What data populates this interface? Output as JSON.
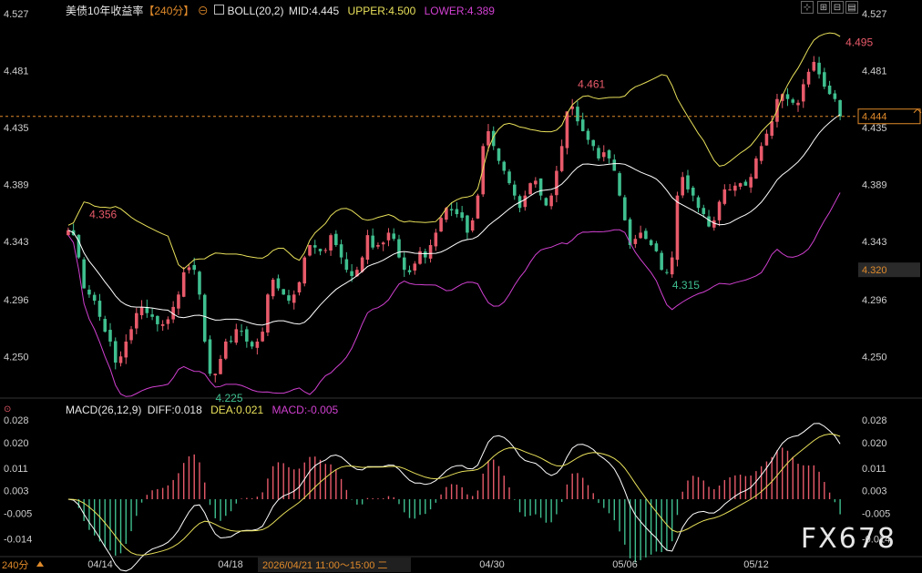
{
  "header": {
    "symbol": "美债10年收益率",
    "period_tag": "【240分】",
    "circle_icon": "⊖",
    "boll_label": "BOLL(20,2)",
    "mid": "MID:4.445",
    "upper": "UPPER:4.500",
    "lower": "LOWER:4.389"
  },
  "macd_header": {
    "label": "MACD(26,12,9)",
    "diff": "DIFF:0.018",
    "dea": "DEA:0.021",
    "macd": "MACD:-0.005"
  },
  "toolbar": {
    "icons": [
      "crosshair-icon",
      "zoom-in-icon",
      "zoom-out-icon",
      "settings-icon"
    ],
    "glyphs": [
      "⊹",
      "⊞",
      "⊟",
      "▤"
    ]
  },
  "price_axis": [
    "4.527",
    "4.481",
    "4.435",
    "4.389",
    "4.343",
    "4.296",
    "4.250"
  ],
  "macd_axis": [
    "0.028",
    "0.020",
    "0.011",
    "0.003",
    "-0.005",
    "-0.014"
  ],
  "markers": {
    "current_price": "4.444",
    "hover_price": "4.320"
  },
  "annotations": {
    "high_1": "4.356",
    "low_1": "4.225",
    "high_2": "4.461",
    "low_2": "4.315",
    "high_3": "4.495"
  },
  "x_axis": {
    "period": "240分",
    "dates": [
      "04/14",
      "04/18",
      "04/30",
      "05/06",
      "05/12"
    ],
    "crosshair_time": "2026/04/21 11:00～15:00 二"
  },
  "watermark": "FX678",
  "colors": {
    "up": "#e85a6a",
    "down": "#3fbf8f",
    "mid": "#ffffff",
    "upper": "#e8e05a",
    "lower": "#d040d0",
    "macd_diff": "#ffffff",
    "macd_dea": "#e8e05a",
    "dash": "#e08a2a"
  },
  "chart_data": {
    "type": "candlestick",
    "price_ylim": [
      4.22,
      4.527
    ],
    "macd_ylim": [
      -0.02,
      0.03
    ],
    "closes": [
      4.352,
      4.348,
      4.33,
      4.305,
      4.3,
      4.295,
      4.282,
      4.27,
      4.262,
      4.245,
      4.25,
      4.262,
      4.272,
      4.285,
      4.29,
      4.285,
      4.282,
      4.276,
      4.276,
      4.28,
      4.29,
      4.3,
      4.318,
      4.322,
      4.32,
      4.3,
      4.262,
      4.236,
      4.236,
      4.248,
      4.262,
      4.262,
      4.272,
      4.27,
      4.262,
      4.258,
      4.262,
      4.27,
      4.3,
      4.312,
      4.305,
      4.3,
      4.295,
      4.3,
      4.31,
      4.33,
      4.34,
      4.338,
      4.335,
      4.336,
      4.348,
      4.34,
      4.33,
      4.32,
      4.315,
      4.32,
      4.33,
      4.348,
      4.338,
      4.34,
      4.342,
      4.35,
      4.345,
      4.33,
      4.32,
      4.318,
      4.325,
      4.335,
      4.33,
      4.34,
      4.35,
      4.362,
      4.37,
      4.368,
      4.365,
      4.362,
      4.35,
      4.36,
      4.38,
      4.42,
      4.432,
      4.42,
      4.408,
      4.4,
      4.39,
      4.38,
      4.37,
      4.38,
      4.39,
      4.392,
      4.38,
      4.372,
      4.38,
      4.4,
      4.42,
      4.448,
      4.452,
      4.44,
      4.432,
      4.425,
      4.42,
      4.41,
      4.415,
      4.41,
      4.4,
      4.38,
      4.36,
      4.34,
      4.345,
      4.35,
      4.345,
      4.34,
      4.335,
      4.32,
      4.318,
      4.33,
      4.38,
      4.395,
      4.385,
      4.38,
      4.37,
      4.365,
      4.355,
      4.36,
      4.375,
      4.385,
      4.385,
      4.388,
      4.39,
      4.388,
      4.395,
      4.41,
      4.42,
      4.43,
      4.44,
      4.458,
      4.462,
      4.458,
      4.455,
      4.455,
      4.47,
      4.48,
      4.488,
      4.478,
      4.468,
      4.462,
      4.458,
      4.444
    ],
    "macd_hist_note": "derived from closes",
    "x_dates": [
      "04/14",
      "04/18",
      "04/30",
      "05/06",
      "05/12"
    ]
  }
}
